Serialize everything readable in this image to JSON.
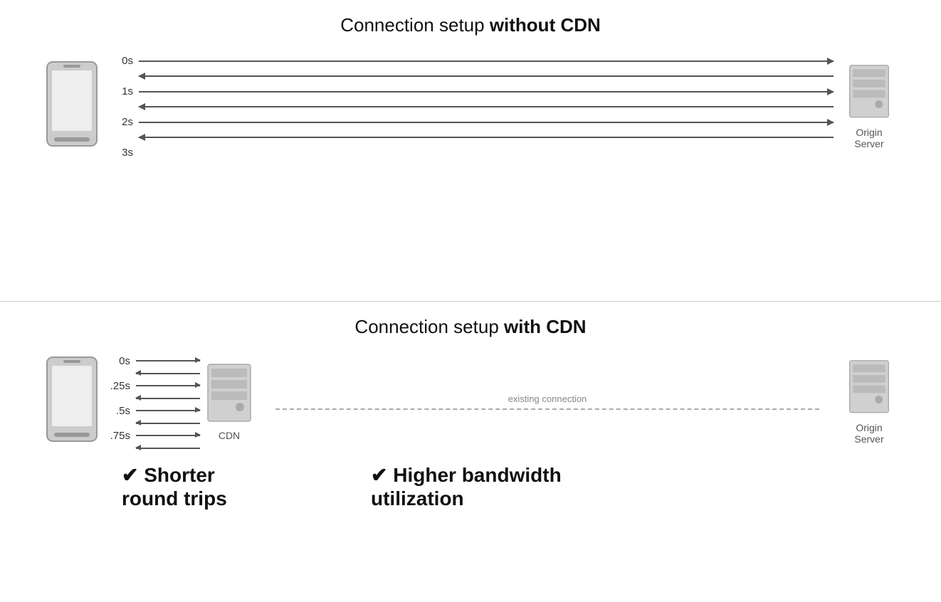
{
  "top_section": {
    "title_normal": "Connection setup ",
    "title_bold": "without CDN",
    "time_labels": [
      "0s",
      "1s",
      "2s",
      "3s"
    ],
    "server_label": "Origin\nServer"
  },
  "bottom_section": {
    "title_normal": "Connection setup ",
    "title_bold": "with CDN",
    "time_labels": [
      "0s",
      ".25s",
      ".5s",
      ".75s"
    ],
    "cdn_label": "CDN",
    "server_label": "Origin\nServer",
    "existing_connection": "existing connection",
    "benefit_left": "✔ Shorter\nround trips",
    "benefit_right": "✔ Higher bandwidth\nutilization"
  }
}
